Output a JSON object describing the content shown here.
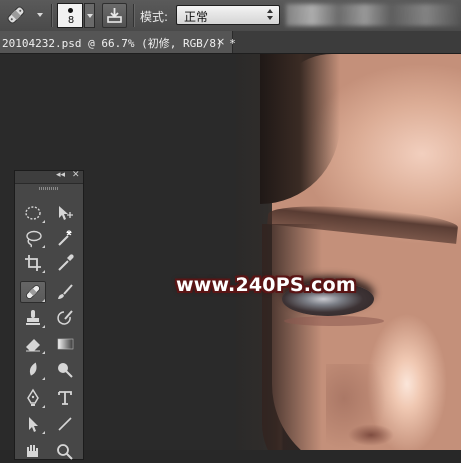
{
  "options_bar": {
    "brush_size": "8",
    "mode_label": "模式:",
    "mode_value": "正常"
  },
  "document": {
    "tab_title": "20104232.psd @ 66.7% (初修, RGB/8) *",
    "close_glyph": "×"
  },
  "canvas": {
    "watermark": "www.240PS.com"
  },
  "tools_panel": {
    "collapse_glyph": "◂◂",
    "close_glyph": "✕",
    "tools": [
      {
        "name": "marquee-tool-icon"
      },
      {
        "name": "move-tool-icon"
      },
      {
        "name": "lasso-tool-icon"
      },
      {
        "name": "magic-wand-tool-icon"
      },
      {
        "name": "crop-tool-icon"
      },
      {
        "name": "eyedropper-tool-icon"
      },
      {
        "name": "healing-brush-tool-icon",
        "active": true
      },
      {
        "name": "brush-tool-icon"
      },
      {
        "name": "clone-stamp-tool-icon"
      },
      {
        "name": "history-brush-tool-icon"
      },
      {
        "name": "eraser-tool-icon"
      },
      {
        "name": "gradient-tool-icon"
      },
      {
        "name": "blur-tool-icon"
      },
      {
        "name": "dodge-tool-icon"
      },
      {
        "name": "pen-tool-icon"
      },
      {
        "name": "type-tool-icon"
      },
      {
        "name": "path-selection-tool-icon"
      },
      {
        "name": "line-tool-icon"
      },
      {
        "name": "hand-tool-icon"
      },
      {
        "name": "zoom-tool-icon"
      }
    ]
  },
  "colors": {
    "options_bar": "#4e4e4e",
    "workspace": "#2a2a2a",
    "panel": "#474747",
    "watermark_outline": "#5a1515"
  }
}
